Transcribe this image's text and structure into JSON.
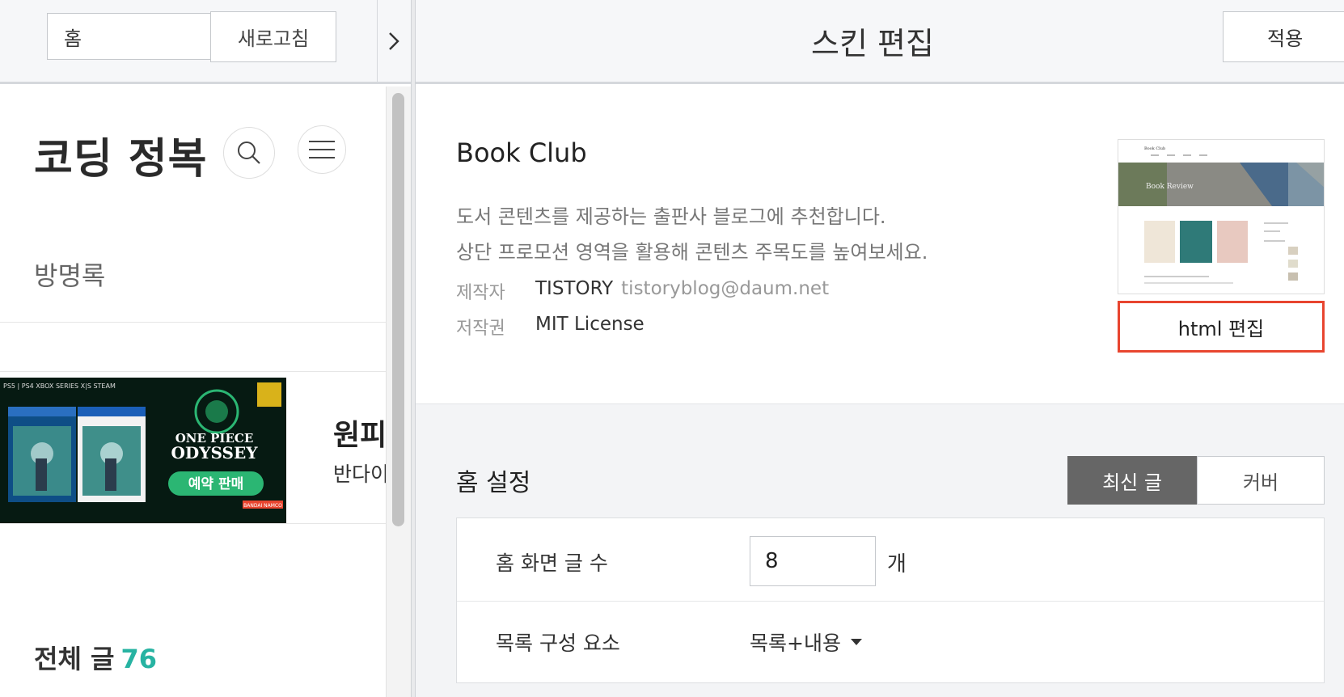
{
  "preview_toolbar": {
    "url_value": "홈",
    "refresh_label": "새로고침",
    "expand_icon": "chevron-right-icon"
  },
  "preview": {
    "blog_title": "코딩 정복",
    "search_icon": "search-icon",
    "menu_icon": "hamburger-menu-icon",
    "guestbook_label": "방명록",
    "ad": {
      "title_fragment": "원피",
      "subtitle_fragment": "반다이",
      "banner_platforms": "PS5 | PS4  XBOX SERIES X|S  STEAM",
      "banner_game_title_1": "ONE PIECE",
      "banner_game_title_2": "ODYSSEY",
      "banner_cta": "예약 판매",
      "banner_publisher": "BANDAI NAMCO"
    },
    "total_posts_label": "전체 글",
    "total_posts_count": "76"
  },
  "editor": {
    "title": "스킨 편집",
    "apply_label": "적용",
    "skin": {
      "name": "Book Club",
      "description_line1": "도서 콘텐츠를 제공하는 출판사 블로그에 추천합니다.",
      "description_line2": "상단 프로모션 영역을 활용해 콘텐츠 주목도를 높여보세요.",
      "author_label": "제작자",
      "author_name": "TISTORY",
      "author_email": "tistoryblog@daum.net",
      "license_label": "저작권",
      "license_value": "MIT License",
      "thumbnail_site_title": "Book Club",
      "thumbnail_banner_text": "Book Review",
      "html_edit_label": "html 편집"
    },
    "home_settings": {
      "heading": "홈 설정",
      "segment_latest": "최신 글",
      "segment_cover": "커버",
      "post_count_label": "홈 화면 글 수",
      "post_count_value": "8",
      "post_count_unit": "개",
      "list_elements_label": "목록 구성 요소",
      "list_elements_value": "목록+내용"
    }
  },
  "colors": {
    "accent_count": "#27b3a2",
    "html_edit_border": "#e8452f",
    "segment_active_bg": "#666666"
  }
}
